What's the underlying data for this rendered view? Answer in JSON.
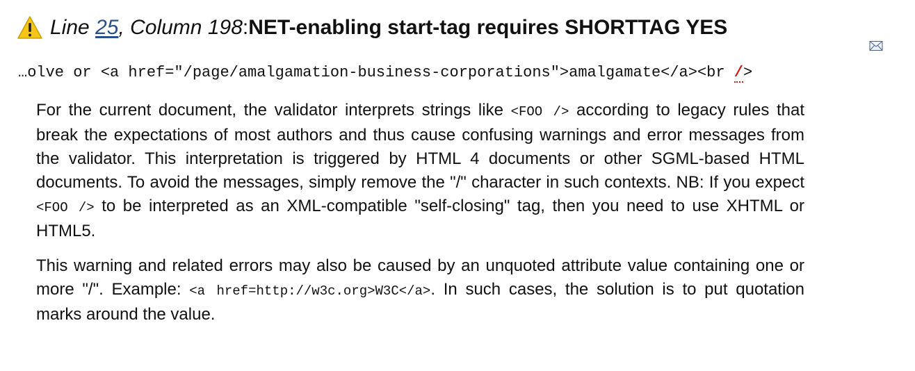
{
  "header": {
    "icon": "warning-icon",
    "line_label": "Line",
    "line_number": "25",
    "sep1": ", ",
    "column_label": "Column 198",
    "sep2": ": ",
    "message": "NET-enabling start-tag requires SHORTTAG YES"
  },
  "mail_icon": "envelope-icon",
  "extract": {
    "before": "…olve or <a href=\"/page/amalgamation-business-corporations\">amalgamate</a><br ",
    "highlight": "/",
    "after": ">"
  },
  "explanation": {
    "p1_a": "For the current document, the validator interprets strings like ",
    "p1_code1": "<FOO />",
    "p1_b": " according to legacy rules that break the expectations of most authors and thus cause confusing warnings and error messages from the validator. This interpretation is triggered by HTML 4 documents or other SGML-based HTML documents. To avoid the messages, simply remove the \"/\" character in such contexts. NB: If you expect ",
    "p1_code2": "<FOO />",
    "p1_c": " to be interpreted as an XML-compatible \"self-closing\" tag, then you need to use XHTML or HTML5.",
    "p2_a": "This warning and related errors may also be caused by an unquoted attribute value containing one or more \"/\". Example: ",
    "p2_code": "<a href=http://w3c.org>W3C</a>",
    "p2_b": ". In such cases, the solution is to put quotation marks around the value."
  },
  "colors": {
    "warning_yellow": "#f5c518",
    "error_red": "#d01818",
    "link_blue": "#2a4f8a"
  }
}
